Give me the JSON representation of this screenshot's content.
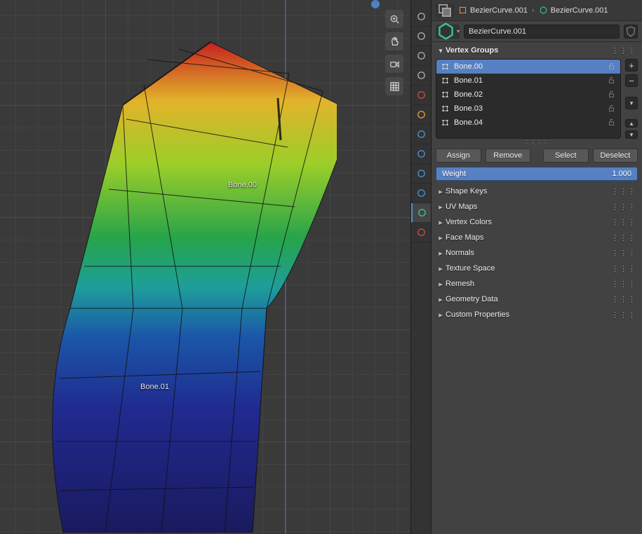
{
  "viewport": {
    "bone_labels": [
      "Bone.00",
      "Bone.01"
    ],
    "tool_icons": [
      "zoom-icon",
      "pan-icon",
      "camera-icon",
      "grid-icon"
    ]
  },
  "breadcrumb": {
    "item1": "BezierCurve.001",
    "item2": "BezierCurve.001"
  },
  "object": {
    "name": "BezierCurve.001"
  },
  "vertex_groups": {
    "heading": "Vertex Groups",
    "items": [
      {
        "name": "Bone.00",
        "selected": true
      },
      {
        "name": "Bone.01",
        "selected": false
      },
      {
        "name": "Bone.02",
        "selected": false
      },
      {
        "name": "Bone.03",
        "selected": false
      },
      {
        "name": "Bone.04",
        "selected": false
      }
    ],
    "buttons": {
      "assign": "Assign",
      "remove": "Remove",
      "select": "Select",
      "deselect": "Deselect"
    },
    "weight_label": "Weight",
    "weight_value": "1.000"
  },
  "sections": [
    "Shape Keys",
    "UV Maps",
    "Vertex Colors",
    "Face Maps",
    "Normals",
    "Texture Space",
    "Remesh",
    "Geometry Data",
    "Custom Properties"
  ],
  "property_tabs": [
    {
      "name": "render-tab",
      "color": "#aaaaaa"
    },
    {
      "name": "output-tab",
      "color": "#aaaaaa"
    },
    {
      "name": "viewlayer-tab",
      "color": "#aaaaaa"
    },
    {
      "name": "scene-tab",
      "color": "#aaaaaa"
    },
    {
      "name": "world-tab",
      "color": "#cc4b3e"
    },
    {
      "name": "object-tab",
      "color": "#e9923e"
    },
    {
      "name": "modifier-tab",
      "color": "#4d90d1"
    },
    {
      "name": "particle-tab",
      "color": "#4d90d1"
    },
    {
      "name": "physics-tab",
      "color": "#4d90d1"
    },
    {
      "name": "constraint-tab",
      "color": "#4d90d1"
    },
    {
      "name": "objectdata-tab",
      "color": "#39c58f",
      "active": true
    },
    {
      "name": "material-tab",
      "color": "#cc4b3e"
    }
  ]
}
